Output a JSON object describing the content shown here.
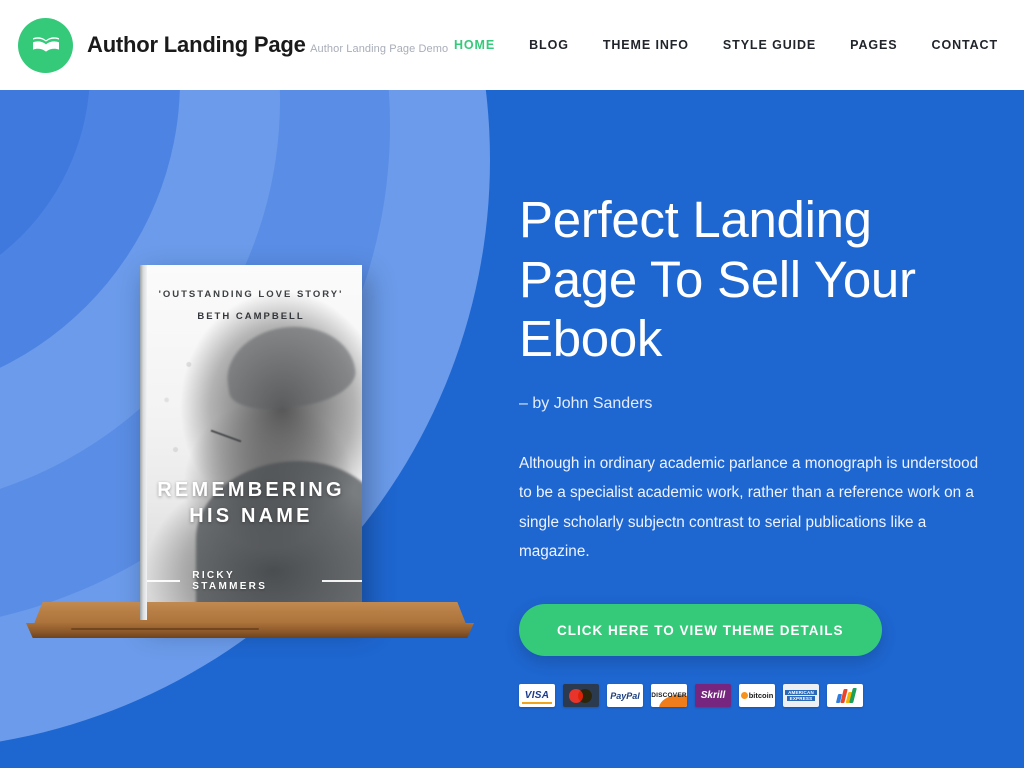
{
  "header": {
    "brand_title": "Author Landing Page",
    "brand_subtitle": "Author Landing Page Demo",
    "logo_icon": "open-book-icon",
    "nav": [
      {
        "label": "HOME",
        "active": true
      },
      {
        "label": "BLOG",
        "active": false
      },
      {
        "label": "THEME INFO",
        "active": false
      },
      {
        "label": "STYLE GUIDE",
        "active": false
      },
      {
        "label": "PAGES",
        "active": false
      },
      {
        "label": "CONTACT",
        "active": false
      }
    ]
  },
  "hero": {
    "title": "Perfect Landing Page To Sell Your Ebook",
    "byline": "– by John Sanders",
    "paragraph": "Although in ordinary academic parlance a monograph is understood to be a specialist academic work, rather than a reference work on a single scholarly subjectn contrast to serial publications like a magazine.",
    "cta_label": "CLICK HERE TO VIEW THEME DETAILS"
  },
  "book": {
    "quote": "'OUTSTANDING LOVE STORY'",
    "endorser": "BETH CAMPBELL",
    "title": "REMEMBERING HIS NAME",
    "author": "RICKY STAMMERS"
  },
  "payments": [
    {
      "name": "visa",
      "label": "VISA"
    },
    {
      "name": "mastercard",
      "label": "MasterCard"
    },
    {
      "name": "paypal",
      "label": "PayPal"
    },
    {
      "name": "discover",
      "label": "DISCOVER"
    },
    {
      "name": "skrill",
      "label": "Skrill"
    },
    {
      "name": "bitcoin",
      "label": "bitcoin"
    },
    {
      "name": "american-express",
      "label_top": "AMERICAN",
      "label_bottom": "EXPRESS"
    },
    {
      "name": "google-wallet",
      "label": "Google Wallet"
    }
  ],
  "colors": {
    "accent_green": "#35c97a",
    "hero_blue": "#1e66d0",
    "deco_blue_light": "#6b9bea",
    "deco_blue_mid": "#5a8de5",
    "header_bg": "#ffffff",
    "shelf_wood": "#b87f45"
  }
}
